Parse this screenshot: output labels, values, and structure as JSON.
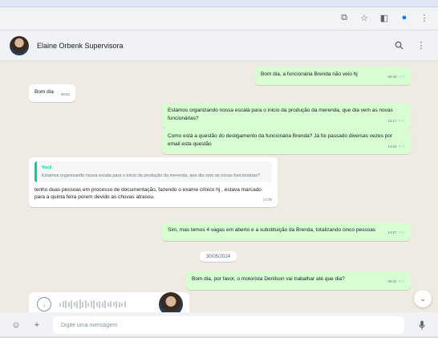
{
  "header": {
    "contact_name": "Elaine Orbenk Supervisora"
  },
  "messages": [
    {
      "text": "Bom dia, a funcionária Brenda não veio hj",
      "time": "09:34"
    },
    {
      "text": "Bom dia",
      "time": "09:52"
    },
    {
      "text": "Estamos organizando nossa escala para o inicio da produção da merenda, que dia vem as novas funcionárias?",
      "time": "13:17"
    },
    {
      "text": "Como está a questão do desligamento da funcionária Brenda? Já foi passado diversas vezes por email esta questão",
      "time": "14:04"
    },
    {
      "quote_author": "Você",
      "quote_text": "Estamos organizando nossa escala para o início da produção da merenda, que dia vem as novas funcionárias?",
      "text": "tenho duas pessoas em processo de documentação, fazendo o exame clínico hj , estava marcado para a quinta feira porem devido as chuvas atrasou.",
      "time": "14:35"
    },
    {
      "text": "Sim, mas temos 4 vagas em aberto e a substituição da Brenda, totalizando cinco pessoas",
      "time": "14:57"
    },
    {
      "text": "Bom dia, por favor, o motorista Denilson vai trabalhar até que dia?",
      "time": "08:31"
    }
  ],
  "date_separator": "30/05/2024",
  "composer": {
    "placeholder": "Digite uma mensagem"
  },
  "icons": {
    "browser": [
      "screen-cast-icon",
      "star-icon",
      "sidebar-icon",
      "profile-icon",
      "more-vert-icon"
    ],
    "header": [
      "search-icon",
      "more-vert-icon"
    ],
    "composer": [
      "emoji-icon",
      "plus-icon",
      "mic-icon"
    ]
  },
  "colors": {
    "chat_background": "#efeae2",
    "outgoing_bubble": "#d9fdd3",
    "incoming_bubble": "#ffffff",
    "read_tick": "#53bdeb",
    "quote_accent": "#06cf9c"
  }
}
